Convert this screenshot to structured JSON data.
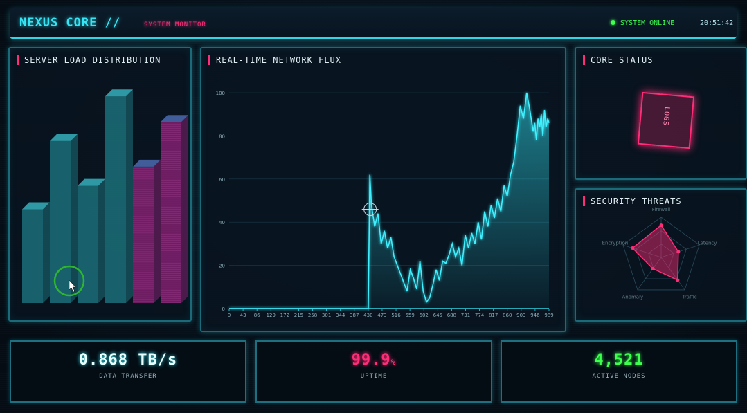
{
  "header": {
    "title": "NEXUS CORE //",
    "subtitle": "SYSTEM MONITOR",
    "status": "SYSTEM ONLINE",
    "time": "20:51:42",
    "status_color": "#3dff4e",
    "accent": "#33e6f5"
  },
  "panels": {
    "load_title": "SERVER LOAD DISTRIBUTION",
    "flux_title": "REAL-TIME NETWORK FLUX",
    "core_title": "CORE STATUS",
    "threat_title": "SECURITY THREATS",
    "core_label": "LOGS"
  },
  "stats": [
    {
      "value": "0.868 TB/s",
      "label": "DATA TRANSFER",
      "color": "#e8ffff"
    },
    {
      "value": "99.9",
      "unit": "%",
      "label": "UPTIME",
      "color": "#ff2d78"
    },
    {
      "value": "4,521",
      "label": "ACTIVE NODES",
      "color": "#3dff4e"
    }
  ],
  "chart_data": [
    {
      "type": "bar",
      "title": "SERVER LOAD DISTRIBUTION",
      "values": [
        44,
        76,
        55,
        97,
        64,
        85
      ],
      "colors": [
        "#1b6a74",
        "#1b6a74",
        "#1b6a74",
        "#1b6a74",
        "#7a1f6a",
        "#7a1f6a"
      ],
      "ylim": [
        0,
        100
      ]
    },
    {
      "type": "line",
      "title": "REAL-TIME NETWORK FLUX",
      "x_ticks": [
        "0",
        "43",
        "86",
        "129",
        "172",
        "215",
        "258",
        "301",
        "344",
        "387",
        "430",
        "473",
        "516",
        "559",
        "602",
        "645",
        "688",
        "731",
        "774",
        "817",
        "860",
        "903",
        "946",
        "989"
      ],
      "y_ticks": [
        "0",
        "20",
        "40",
        "60",
        "80",
        "100"
      ],
      "ylim": [
        0,
        100
      ],
      "xlim": [
        0,
        989
      ],
      "series": [
        {
          "x": [
            0,
            430,
            435,
            440,
            450,
            460,
            470,
            480,
            490,
            500,
            510,
            520,
            530,
            540,
            550,
            560,
            570,
            580,
            590,
            600,
            610,
            620,
            630,
            640,
            650,
            660,
            670,
            680,
            690,
            700,
            710,
            720,
            730,
            740,
            750,
            760,
            770,
            780,
            790,
            800,
            810,
            820,
            830,
            840,
            850,
            860,
            870,
            880,
            890,
            900,
            910,
            920,
            930,
            940,
            945,
            950,
            955,
            960,
            965,
            970,
            975,
            980,
            985,
            989
          ],
          "y": [
            0,
            0,
            62,
            48,
            38,
            44,
            30,
            36,
            28,
            33,
            24,
            20,
            16,
            12,
            8,
            18,
            14,
            9,
            22,
            8,
            3,
            5,
            11,
            18,
            13,
            22,
            21,
            25,
            30,
            24,
            28,
            20,
            34,
            28,
            35,
            30,
            40,
            32,
            45,
            38,
            48,
            42,
            51,
            45,
            57,
            52,
            62,
            68,
            80,
            94,
            88,
            100,
            92,
            82,
            86,
            78,
            88,
            84,
            90,
            80,
            92,
            84,
            88,
            86
          ]
        }
      ]
    },
    {
      "type": "radar",
      "title": "SECURITY THREATS",
      "axes": [
        "Firewall",
        "Latency",
        "Traffic",
        "Anomaly",
        "Encryption"
      ],
      "values": [
        80,
        45,
        70,
        35,
        75
      ],
      "max": 100
    }
  ]
}
